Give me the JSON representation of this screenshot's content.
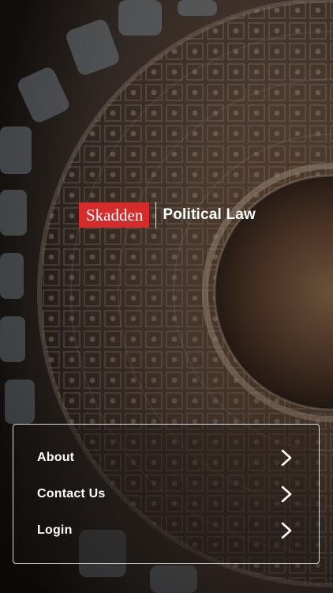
{
  "logo": {
    "brand": "Skadden",
    "product": "Political Law"
  },
  "menu": {
    "items": [
      {
        "label": "About",
        "icon": "chevron-right-icon"
      },
      {
        "label": "Contact Us",
        "icon": "chevron-right-icon"
      },
      {
        "label": "Login",
        "icon": "chevron-right-icon"
      }
    ]
  },
  "colors": {
    "brand_red": "#d62b2b",
    "text": "#ffffff",
    "menu_border": "#ffffff"
  }
}
